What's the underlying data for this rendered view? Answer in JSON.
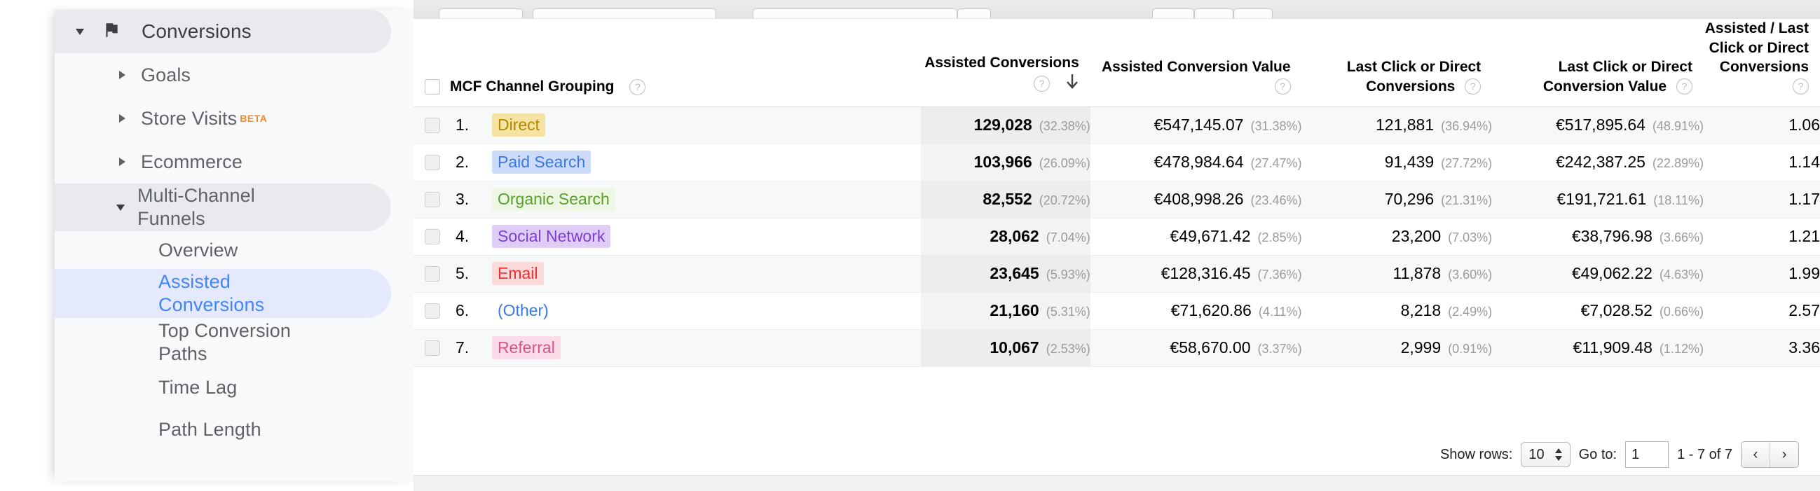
{
  "sidebar": {
    "items": [
      {
        "label": "Conversions",
        "icon": "flag-icon",
        "toggle": "chevron-down-icon",
        "level": 0,
        "state": "expanded-header"
      },
      {
        "label": "Goals",
        "toggle": "chevron-right-icon",
        "level": 1,
        "state": "normal"
      },
      {
        "label": "Store Visits",
        "badge": "BETA",
        "toggle": "chevron-right-icon",
        "level": 1,
        "state": "normal"
      },
      {
        "label": "Ecommerce",
        "toggle": "chevron-right-icon",
        "level": 1,
        "state": "normal"
      },
      {
        "label": "Multi-Channel Funnels",
        "toggle": "chevron-down-icon",
        "level": 1,
        "state": "expanded"
      },
      {
        "label": "Overview",
        "level": 2,
        "state": "normal"
      },
      {
        "label": "Assisted Conversions",
        "level": 2,
        "state": "selected"
      },
      {
        "label": "Top Conversion Paths",
        "level": 2,
        "state": "normal"
      },
      {
        "label": "Time Lag",
        "level": 2,
        "state": "normal"
      },
      {
        "label": "Path Length",
        "level": 2,
        "state": "normal"
      }
    ]
  },
  "table": {
    "select_all_checkbox": "unchecked",
    "columns": [
      {
        "id": "dimension",
        "label": "MCF Channel Grouping",
        "help": "?",
        "align": "left"
      },
      {
        "id": "assisted_conversions",
        "label": "Assisted Conversions",
        "help": "?",
        "align": "right",
        "sorted": true,
        "sort_dir": "descending",
        "sort_icon": "arrow-down-icon"
      },
      {
        "id": "assisted_conversion_value",
        "label": "Assisted Conversion Value",
        "help": "?",
        "align": "right"
      },
      {
        "id": "last_click_conversions",
        "label": "Last Click or Direct Conversions",
        "help": "?",
        "align": "right"
      },
      {
        "id": "last_click_conversion_value",
        "label": "Last Click or Direct Conversion Value",
        "help": "?",
        "align": "right"
      },
      {
        "id": "ratio",
        "label": "Assisted / Last Click or Direct Conversions",
        "help": "?",
        "align": "right"
      }
    ],
    "rows": [
      {
        "index": "1.",
        "channel": "Direct",
        "chip_color": "#b08900",
        "chip_bg": "#f4e3a3",
        "assisted_conversions": "129,028",
        "assisted_conversions_pct": "(32.38%)",
        "assisted_conversion_value": "€547,145.07",
        "assisted_conversion_value_pct": "(31.38%)",
        "last_click_conversions": "121,881",
        "last_click_conversions_pct": "(36.94%)",
        "last_click_conversion_value": "€517,895.64",
        "last_click_conversion_value_pct": "(48.91%)",
        "ratio": "1.06"
      },
      {
        "index": "2.",
        "channel": "Paid Search",
        "chip_color": "#3b78e7",
        "chip_bg": "#ccdcf8",
        "assisted_conversions": "103,966",
        "assisted_conversions_pct": "(26.09%)",
        "assisted_conversion_value": "€478,984.64",
        "assisted_conversion_value_pct": "(27.47%)",
        "last_click_conversions": "91,439",
        "last_click_conversions_pct": "(27.72%)",
        "last_click_conversion_value": "€242,387.25",
        "last_click_conversion_value_pct": "(22.89%)",
        "ratio": "1.14"
      },
      {
        "index": "3.",
        "channel": "Organic Search",
        "chip_color": "#5aa02c",
        "chip_bg": "#edf7e3",
        "assisted_conversions": "82,552",
        "assisted_conversions_pct": "(20.72%)",
        "assisted_conversion_value": "€408,998.26",
        "assisted_conversion_value_pct": "(23.46%)",
        "last_click_conversions": "70,296",
        "last_click_conversions_pct": "(21.31%)",
        "last_click_conversion_value": "€191,721.61",
        "last_click_conversion_value_pct": "(18.11%)",
        "ratio": "1.17"
      },
      {
        "index": "4.",
        "channel": "Social Network",
        "chip_color": "#7c3fd6",
        "chip_bg": "#dfcdf8",
        "assisted_conversions": "28,062",
        "assisted_conversions_pct": "(7.04%)",
        "assisted_conversion_value": "€49,671.42",
        "assisted_conversion_value_pct": "(2.85%)",
        "last_click_conversions": "23,200",
        "last_click_conversions_pct": "(7.03%)",
        "last_click_conversion_value": "€38,796.98",
        "last_click_conversion_value_pct": "(3.66%)",
        "ratio": "1.21"
      },
      {
        "index": "5.",
        "channel": "Email",
        "chip_color": "#f03030",
        "chip_bg": "#fddada",
        "assisted_conversions": "23,645",
        "assisted_conversions_pct": "(5.93%)",
        "assisted_conversion_value": "€128,316.45",
        "assisted_conversion_value_pct": "(7.36%)",
        "last_click_conversions": "11,878",
        "last_click_conversions_pct": "(3.60%)",
        "last_click_conversion_value": "€49,062.22",
        "last_click_conversion_value_pct": "(4.63%)",
        "ratio": "1.99"
      },
      {
        "index": "6.",
        "channel": "(Other)",
        "chip_color": "#3b78e7",
        "chip_bg": "transparent",
        "assisted_conversions": "21,160",
        "assisted_conversions_pct": "(5.31%)",
        "assisted_conversion_value": "€71,620.86",
        "assisted_conversion_value_pct": "(4.11%)",
        "last_click_conversions": "8,218",
        "last_click_conversions_pct": "(2.49%)",
        "last_click_conversion_value": "€7,028.52",
        "last_click_conversion_value_pct": "(0.66%)",
        "ratio": "2.57"
      },
      {
        "index": "7.",
        "channel": "Referral",
        "chip_color": "#d3568f",
        "chip_bg": "#fbdbe8",
        "assisted_conversions": "10,067",
        "assisted_conversions_pct": "(2.53%)",
        "assisted_conversion_value": "€58,670.00",
        "assisted_conversion_value_pct": "(3.37%)",
        "last_click_conversions": "2,999",
        "last_click_conversions_pct": "(0.91%)",
        "last_click_conversion_value": "€11,909.48",
        "last_click_conversion_value_pct": "(1.12%)",
        "ratio": "3.36"
      }
    ]
  },
  "footer": {
    "show_rows_label": "Show rows:",
    "show_rows_value": "10",
    "goto_label": "Go to:",
    "goto_value": "1",
    "range_label": "1 - 7 of 7",
    "prev_icon": "‹",
    "next_icon": "›"
  }
}
